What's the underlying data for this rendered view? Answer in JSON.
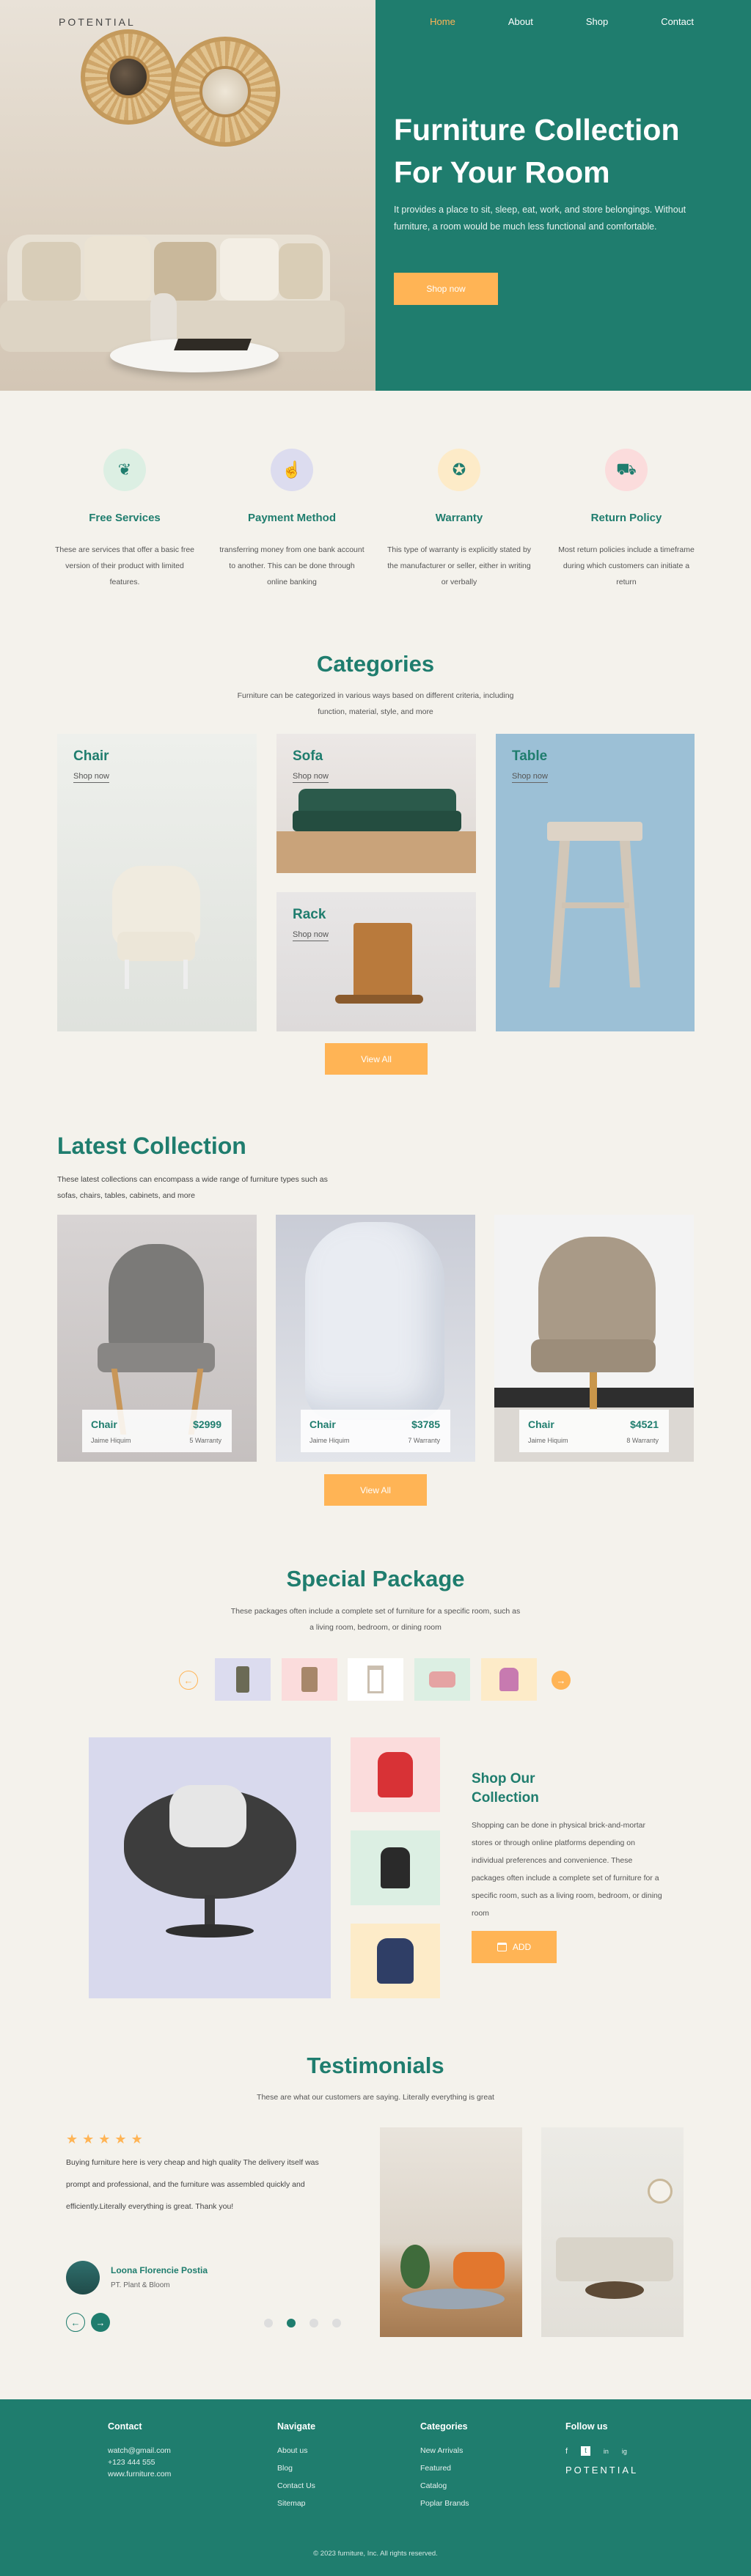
{
  "brand": {
    "logo": "POTENTIAL"
  },
  "nav": {
    "home": "Home",
    "about": "About",
    "shop": "Shop",
    "contact": "Contact"
  },
  "hero": {
    "title": "Furniture Collection For Your Room",
    "text": "It provides a place to sit, sleep, eat, work, and store belongings. Without furniture, a room would be much less functional and comfortable.",
    "button": "Shop now"
  },
  "services": [
    {
      "title": "Free Services",
      "text": "These are services that offer a basic free version of their product with limited features.",
      "icon": "leaf-icon",
      "bg": "#dcefe3"
    },
    {
      "title": "Payment Method",
      "text": "transferring money from one bank account to another. This can be done through online banking",
      "icon": "hand-coin-icon",
      "bg": "#dcdcef"
    },
    {
      "title": "Warranty",
      "text": "This type of warranty is explicitly stated by the manufacturer or seller, either in writing or verbally",
      "icon": "badge-icon",
      "bg": "#fdebc8"
    },
    {
      "title": "Return Policy",
      "text": "Most return policies include a timeframe during which customers can initiate a return",
      "icon": "scooter-icon",
      "bg": "#fbdcdc"
    }
  ],
  "categories": {
    "title": "Categories",
    "sub": "Furniture can be categorized in various ways based on different criteria, including function, material, style, and more",
    "items": [
      {
        "label": "Chair",
        "shop": "Shop now"
      },
      {
        "label": "Sofa",
        "shop": "Shop now"
      },
      {
        "label": "Rack",
        "shop": "Shop now"
      },
      {
        "label": "Table",
        "shop": "Shop now"
      }
    ],
    "button": "View All"
  },
  "latest": {
    "title": "Latest Collection",
    "sub": "These latest collections can encompass a wide range of furniture types such as sofas, chairs, tables, cabinets, and more",
    "items": [
      {
        "name": "Chair",
        "price": "$2999",
        "maker": "Jaime Hiquim",
        "warranty": "5 Warranty"
      },
      {
        "name": "Chair",
        "price": "$3785",
        "maker": "Jaime Hiquim",
        "warranty": "7 Warranty"
      },
      {
        "name": "Chair",
        "price": "$4521",
        "maker": "Jaime Hiquim",
        "warranty": "8 Warranty"
      }
    ],
    "button": "View All"
  },
  "package": {
    "title": "Special Package",
    "sub": "These packages often include a complete set of furniture for a specific room, such as a living room, bedroom, or dining room",
    "thumb_colors": [
      "#dcdcef",
      "#fbdcdc",
      "#ffffff",
      "#dcefe3",
      "#fdebc8"
    ],
    "shop_title": "Shop Our Collection",
    "shop_text": "Shopping can be done in physical brick-and-mortar stores or through online platforms depending on individual preferences and convenience. These packages often include a complete set of furniture for a specific room, such as a living room, bedroom, or dining room",
    "add": "ADD"
  },
  "testimonials": {
    "title": "Testimonials",
    "sub": "These are what our customers are saying. Literally everything is great",
    "quote": "Buying furniture here is very cheap and high quality The delivery itself was prompt and professional, and the furniture was assembled quickly and efficiently.Literally everything is great. Thank you!",
    "name": "Loona Florencie Postia",
    "company": "PT. Plant & Bloom"
  },
  "footer": {
    "contact_h": "Contact",
    "contact": [
      "watch@gmail.com",
      "+123 444 555",
      "www.furniture.com"
    ],
    "navigate_h": "Navigate",
    "navigate": [
      "About us",
      "Blog",
      "Contact Us",
      "Sitemap"
    ],
    "categories_h": "Categories",
    "categories": [
      "New Arrivals",
      "Featured",
      "Catalog",
      "Poplar Brands"
    ],
    "follow_h": "Follow us",
    "social": [
      "f",
      "t",
      "in",
      "ig"
    ],
    "logo": "POTENTIAL",
    "copyright": "© 2023 furniture, Inc. All rights reserved."
  }
}
